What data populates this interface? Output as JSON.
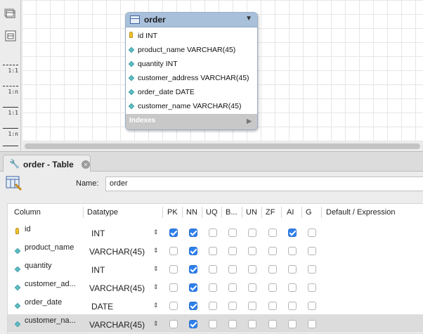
{
  "entity": {
    "title": "order",
    "columns": [
      {
        "text": "id INT",
        "icon": "primary-key-icon"
      },
      {
        "text": "product_name VARCHAR(45)",
        "icon": "column-diamond-icon"
      },
      {
        "text": "quantity INT",
        "icon": "column-diamond-icon"
      },
      {
        "text": "customer_address VARCHAR(45)",
        "icon": "column-diamond-icon"
      },
      {
        "text": "order_date DATE",
        "icon": "column-diamond-icon"
      },
      {
        "text": "customer_name VARCHAR(45)",
        "icon": "column-diamond-icon"
      }
    ],
    "indexes_label": "Indexes"
  },
  "palette": {
    "relations": [
      "1:1",
      "1:n",
      "1:1",
      "1:n"
    ]
  },
  "tab": {
    "title": "order - Table"
  },
  "name_field": {
    "label": "Name:",
    "value": "order"
  },
  "grid": {
    "headers": {
      "column": "Column",
      "datatype": "Datatype",
      "pk": "PK",
      "nn": "NN",
      "uq": "UQ",
      "b": "B...",
      "un": "UN",
      "zf": "ZF",
      "ai": "AI",
      "g": "G",
      "default": "Default / Expression"
    },
    "rows": [
      {
        "name": "id",
        "type": "INT",
        "pk": true,
        "nn": true,
        "uq": false,
        "b": false,
        "un": false,
        "zf": false,
        "ai": true,
        "g": false,
        "key": true
      },
      {
        "name": "product_name",
        "type": "VARCHAR(45)",
        "pk": false,
        "nn": true,
        "uq": false,
        "b": false,
        "un": false,
        "zf": false,
        "ai": false,
        "g": false,
        "key": false
      },
      {
        "name": "quantity",
        "type": "INT",
        "pk": false,
        "nn": true,
        "uq": false,
        "b": false,
        "un": false,
        "zf": false,
        "ai": false,
        "g": false,
        "key": false
      },
      {
        "name": "customer_ad...",
        "type": "VARCHAR(45)",
        "pk": false,
        "nn": true,
        "uq": false,
        "b": false,
        "un": false,
        "zf": false,
        "ai": false,
        "g": false,
        "key": false
      },
      {
        "name": "order_date",
        "type": "DATE",
        "pk": false,
        "nn": true,
        "uq": false,
        "b": false,
        "un": false,
        "zf": false,
        "ai": false,
        "g": false,
        "key": false
      },
      {
        "name": "customer_na...",
        "type": "VARCHAR(45)",
        "pk": false,
        "nn": true,
        "uq": false,
        "b": false,
        "un": false,
        "zf": false,
        "ai": false,
        "g": false,
        "key": false,
        "selected": true
      }
    ]
  }
}
